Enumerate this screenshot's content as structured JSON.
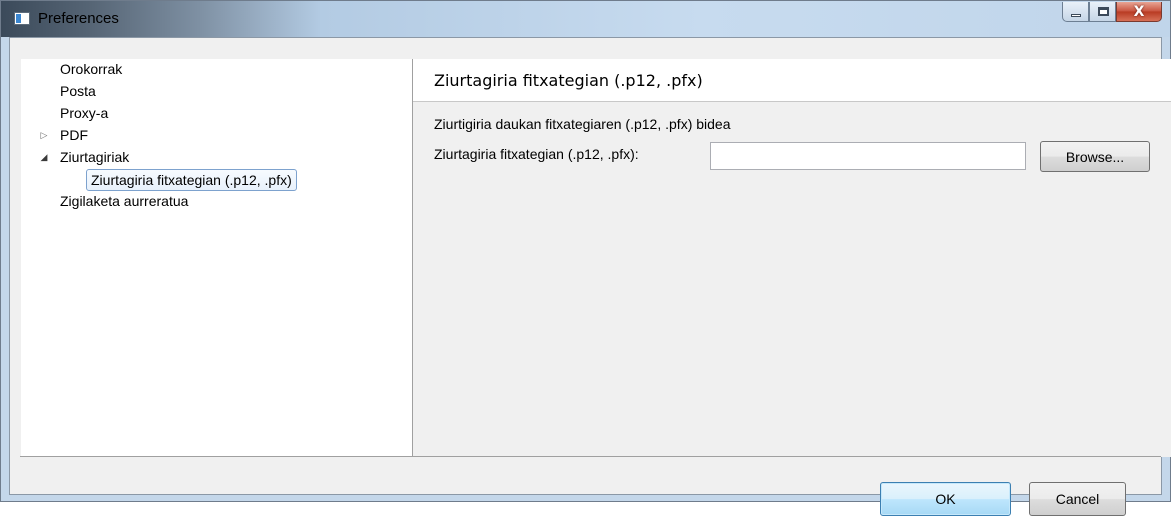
{
  "window": {
    "title": "Preferences",
    "controls": {
      "minimize": "minimize",
      "maximize": "maximize",
      "close": "X"
    }
  },
  "tree": {
    "items": [
      {
        "label": "Orokorrak",
        "expander": ""
      },
      {
        "label": "Posta",
        "expander": ""
      },
      {
        "label": "Proxy-a",
        "expander": ""
      },
      {
        "label": "PDF",
        "expander": "▷"
      },
      {
        "label": "Ziurtagiriak",
        "expander": "◢"
      },
      {
        "label": "Ziurtagiria fitxategian (.p12, .pfx)",
        "expander": "",
        "selected": true
      },
      {
        "label": "Zigilaketa aurreratua",
        "expander": ""
      }
    ]
  },
  "page": {
    "title": "Ziurtagiria fitxategian (.p12, .pfx)",
    "description": "Ziurtigiria daukan fitxategiaren (.p12, .pfx) bidea",
    "field_label": "Ziurtagiria fitxategian (.p12, .pfx):",
    "field_value": "",
    "browse_label": "Browse..."
  },
  "footer": {
    "ok_label": "OK",
    "cancel_label": "Cancel"
  },
  "icons": {
    "app": "preferences-window-icon",
    "collapsed": "triangle-right-icon",
    "expanded": "triangle-down-icon"
  }
}
